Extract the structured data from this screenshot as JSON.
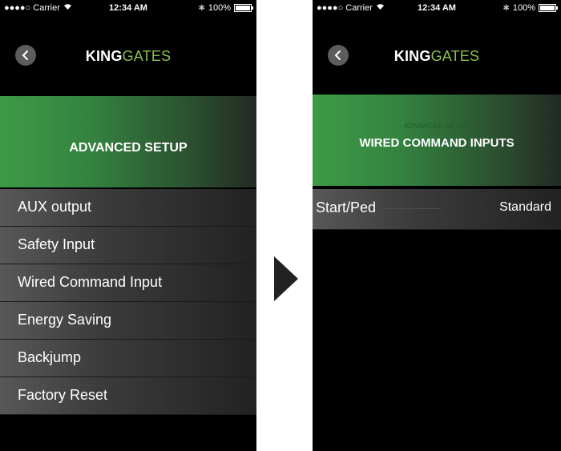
{
  "status_bar": {
    "carrier": "●●●●○ Carrier",
    "time": "12:34 AM",
    "battery": "100%",
    "icons": [
      "wifi-icon",
      "bluetooth-icon",
      "battery-icon"
    ]
  },
  "nav": {
    "logo_bold": "KING",
    "logo_light": "GATES",
    "back_icon": "chevron-left-icon"
  },
  "left_screen": {
    "title": "ADVANCED SETUP",
    "items": [
      {
        "label": "AUX output"
      },
      {
        "label": "Safety Input"
      },
      {
        "label": "Wired Command Input"
      },
      {
        "label": "Energy Saving"
      },
      {
        "label": "Backjump"
      },
      {
        "label": "Factory Reset"
      }
    ]
  },
  "right_screen": {
    "subtitle": "- ADVANCED SETUP -",
    "title": "WIRED COMMAND INPUTS",
    "items": [
      {
        "label": "Start/Ped",
        "value": "Standard"
      }
    ]
  },
  "colors": {
    "brand_green": "#8ac04a",
    "hero_green": "#3d9b46"
  }
}
